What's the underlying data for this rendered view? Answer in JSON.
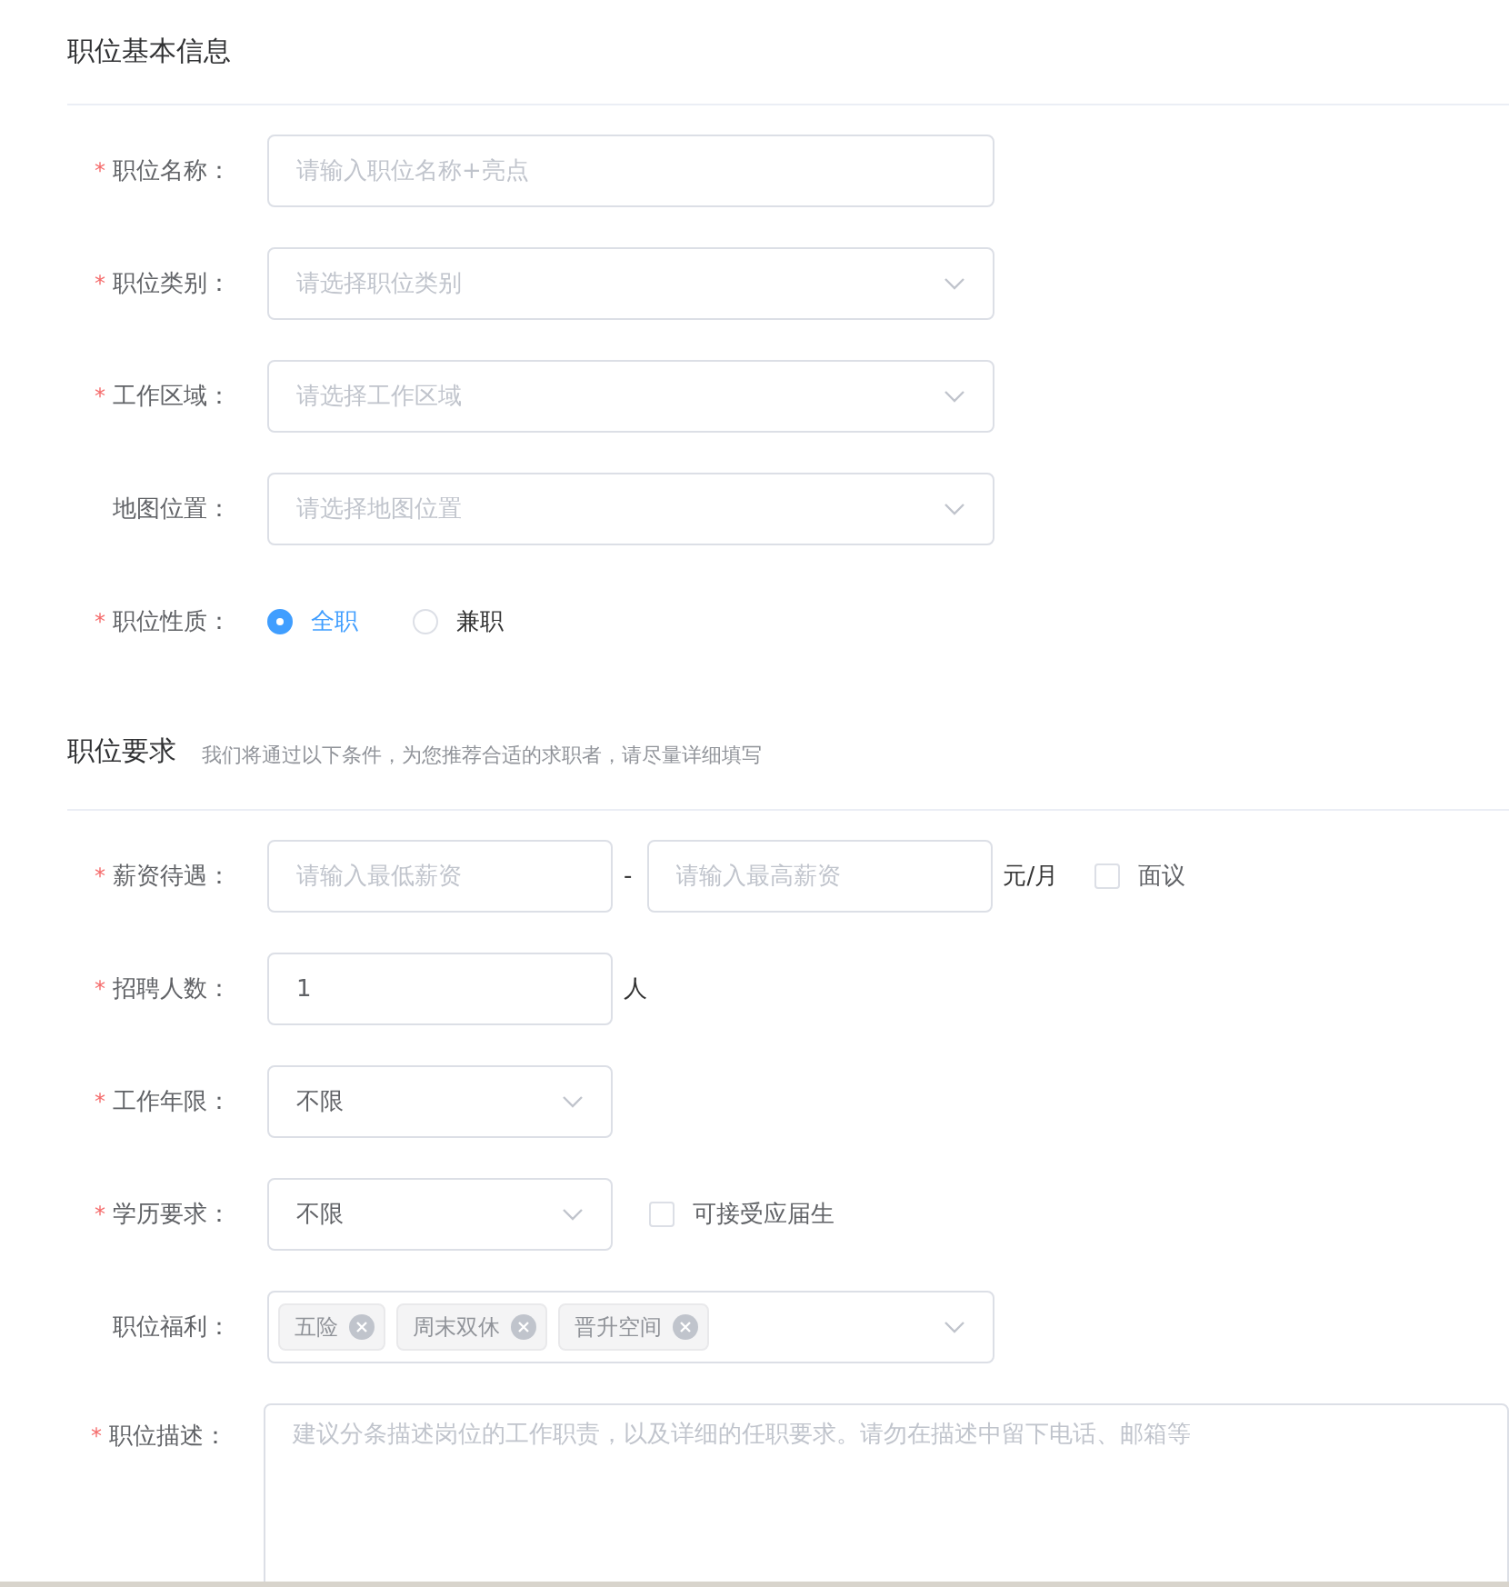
{
  "sections": [
    {
      "title": "职位基本信息",
      "fields": [
        {
          "label": "职位名称：",
          "required_mark": "*",
          "kind": "text",
          "placeholder": "请输入职位名称+亮点"
        },
        {
          "label": "职位类别：",
          "required_mark": "*",
          "kind": "select",
          "placeholder": "请选择职位类别"
        },
        {
          "label": "工作区域：",
          "required_mark": "*",
          "kind": "select",
          "placeholder": "请选择工作区域"
        },
        {
          "label": "地图位置：",
          "kind": "select",
          "placeholder": "请选择地图位置"
        },
        {
          "label": "职位性质：",
          "required_mark": "*",
          "kind": "radio",
          "options": [
            {
              "label": "全职",
              "selected": true
            },
            {
              "label": "兼职",
              "selected": false
            }
          ]
        }
      ]
    },
    {
      "title": "职位要求",
      "subtitle": "我们将通过以下条件，为您推荐合适的求职者，请尽量详细填写",
      "fields": [
        {
          "label": "薪资待遇：",
          "required_mark": "*",
          "kind": "range",
          "placeholders": [
            "请输入最低薪资",
            "请输入最高薪资"
          ],
          "separator": "-",
          "unit": "元/月",
          "checkbox": {
            "label": "面议",
            "checked": false
          }
        },
        {
          "label": "招聘人数：",
          "required_mark": "*",
          "kind": "number",
          "value": "1",
          "unit": "人"
        },
        {
          "label": "工作年限：",
          "required_mark": "*",
          "kind": "short_select",
          "value": "不限"
        },
        {
          "label": "学历要求：",
          "required_mark": "*",
          "kind": "short_select",
          "value": "不限",
          "checkbox": {
            "label": "可接受应届生",
            "checked": false
          }
        },
        {
          "label": "职位福利：",
          "kind": "tags",
          "tags": [
            "五险",
            "周末双休",
            "晋升空间"
          ]
        },
        {
          "label": "职位描述：",
          "required_mark": "*",
          "kind": "textarea",
          "placeholder": "建议分条描述岗位的工作职责，以及详细的任职要求。请勿在描述中留下电话、邮箱等"
        }
      ]
    }
  ]
}
